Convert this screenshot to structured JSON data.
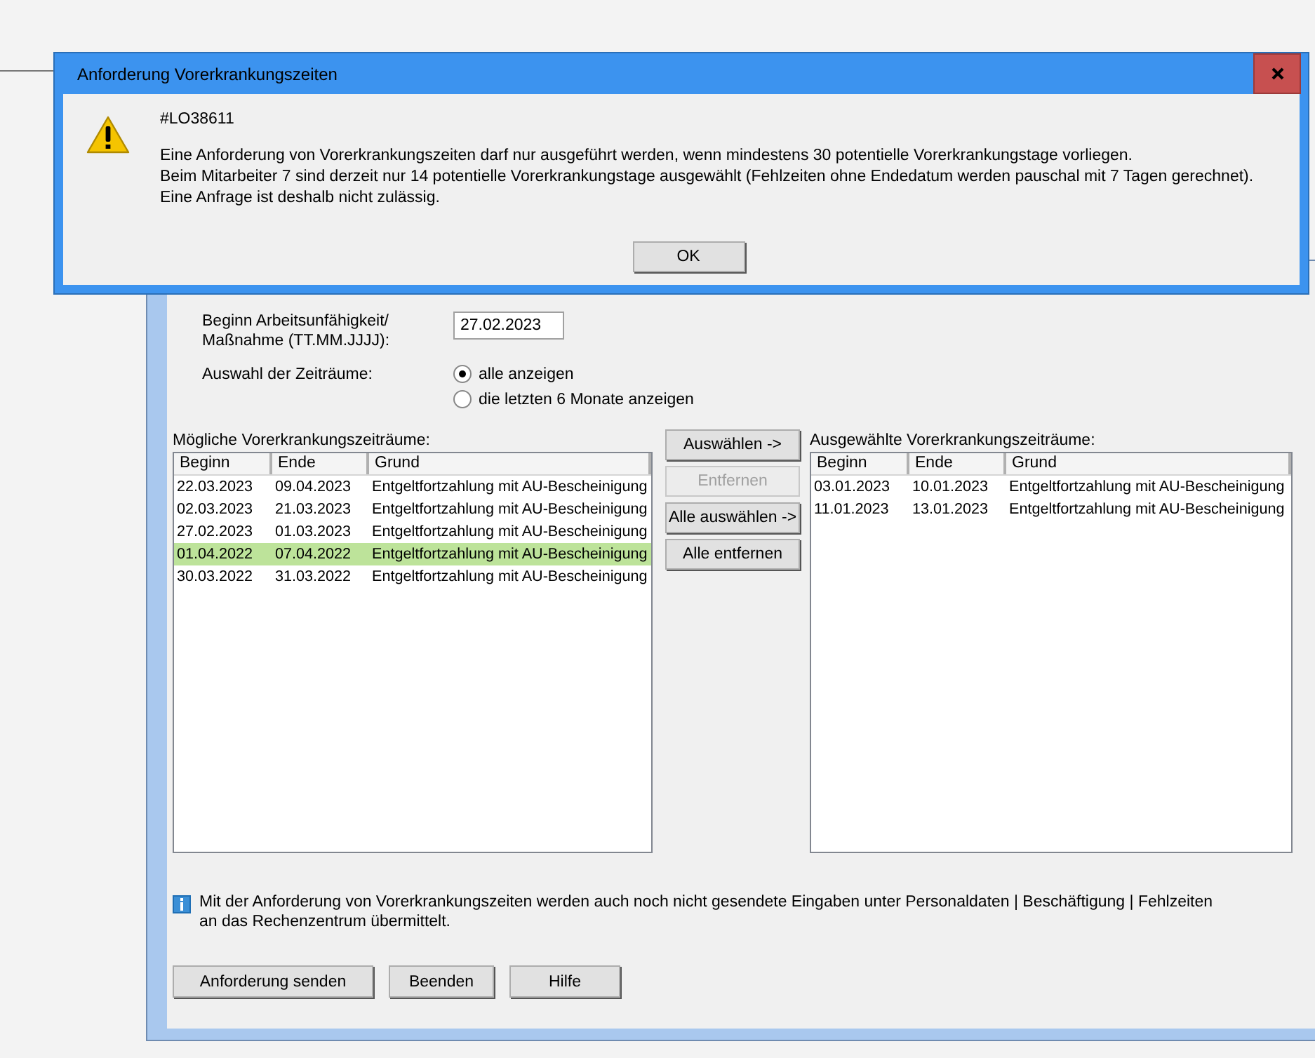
{
  "dialog": {
    "title": "Anforderung Vorerkrankungszeiten",
    "code": "#LO38611",
    "message_lines": [
      "Eine Anforderung von Vorerkrankungszeiten darf nur ausgeführt werden, wenn mindestens 30 potentielle Vorerkrankungstage vorliegen.",
      "Beim Mitarbeiter 7 sind derzeit nur 14 potentielle Vorerkrankungstage ausgewählt (Fehlzeiten ohne Endedatum werden pauschal mit 7 Tagen gerechnet).",
      "Eine Anfrage ist deshalb nicht zulässig."
    ],
    "ok_button": "OK"
  },
  "form": {
    "start_label": "Beginn Arbeitsunfähigkeit/\nMaßnahme (TT.MM.JJJJ):",
    "start_value": "27.02.2023",
    "period_label": "Auswahl der Zeiträume:",
    "period_options": [
      {
        "label": "alle anzeigen",
        "selected": true
      },
      {
        "label": "die letzten 6 Monate anzeigen",
        "selected": false
      }
    ]
  },
  "possible": {
    "title": "Mögliche Vorerkrankungszeiträume:",
    "columns": [
      "Beginn",
      "Ende",
      "Grund"
    ],
    "rows": [
      {
        "cells": [
          "22.03.2023",
          "09.04.2023",
          "Entgeltfortzahlung mit AU-Bescheinigung"
        ],
        "selected": false
      },
      {
        "cells": [
          "02.03.2023",
          "21.03.2023",
          "Entgeltfortzahlung mit AU-Bescheinigung"
        ],
        "selected": false
      },
      {
        "cells": [
          "27.02.2023",
          "01.03.2023",
          "Entgeltfortzahlung mit AU-Bescheinigung"
        ],
        "selected": false
      },
      {
        "cells": [
          "01.04.2022",
          "07.04.2022",
          "Entgeltfortzahlung mit AU-Bescheinigung"
        ],
        "selected": true
      },
      {
        "cells": [
          "30.03.2022",
          "31.03.2022",
          "Entgeltfortzahlung mit AU-Bescheinigung"
        ],
        "selected": false
      }
    ]
  },
  "transfer_buttons": [
    {
      "label": "Auswählen ->",
      "disabled": false
    },
    {
      "label": "Entfernen",
      "disabled": true
    },
    {
      "label": "Alle auswählen ->",
      "disabled": false
    },
    {
      "label": "Alle entfernen",
      "disabled": false
    }
  ],
  "chosen": {
    "title": "Ausgewählte Vorerkrankungszeiträume:",
    "columns": [
      "Beginn",
      "Ende",
      "Grund"
    ],
    "rows": [
      {
        "cells": [
          "03.01.2023",
          "10.01.2023",
          "Entgeltfortzahlung mit AU-Bescheinigung"
        ],
        "selected": false
      },
      {
        "cells": [
          "11.01.2023",
          "13.01.2023",
          "Entgeltfortzahlung mit AU-Bescheinigung"
        ],
        "selected": false
      }
    ]
  },
  "info_lines": [
    "Mit der Anforderung von Vorerkrankungszeiten werden auch noch nicht gesendete Eingaben unter Personaldaten | Beschäftigung | Fehlzeiten",
    "an das Rechenzentrum übermittelt."
  ],
  "bottom_buttons": [
    "Anforderung senden",
    "Beenden",
    "Hilfe"
  ]
}
